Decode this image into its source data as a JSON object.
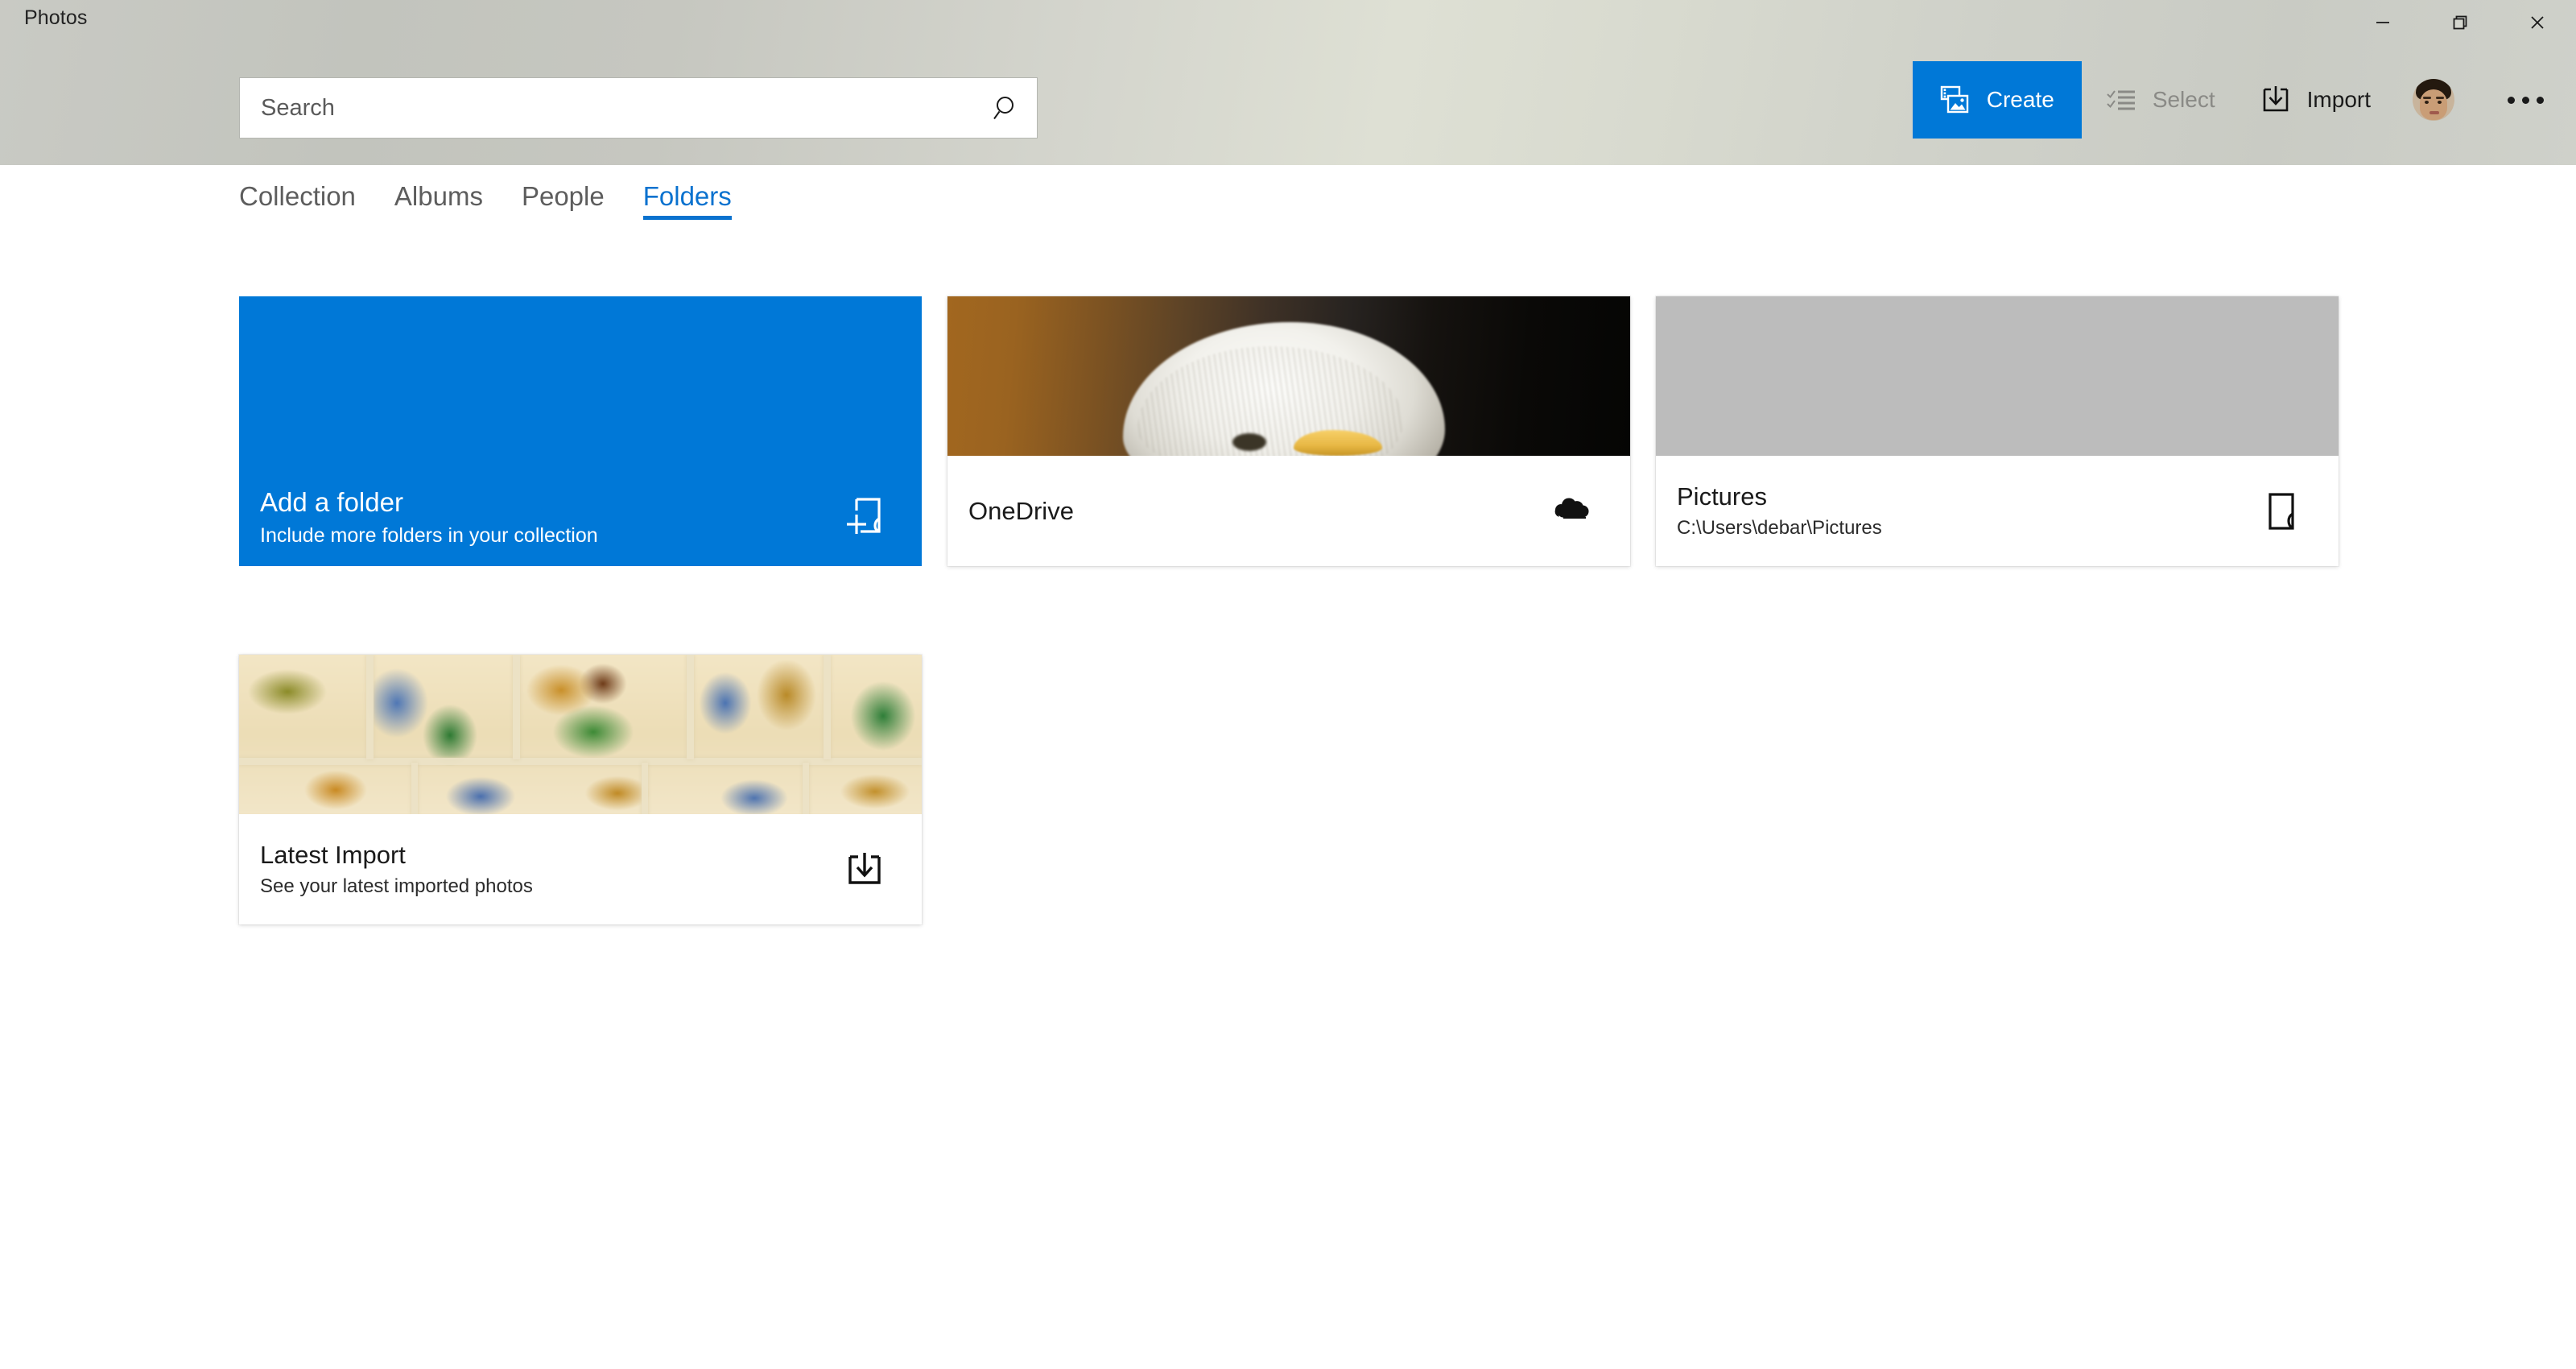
{
  "window": {
    "app_title": "Photos",
    "controls": [
      {
        "name": "minimize",
        "glyph": "minimize-icon"
      },
      {
        "name": "restore",
        "glyph": "restore-icon"
      },
      {
        "name": "close",
        "glyph": "close-icon"
      }
    ]
  },
  "search": {
    "placeholder": "Search",
    "value": "",
    "icon": "search-icon"
  },
  "commandbar": {
    "items": [
      {
        "label": "Create",
        "icon": "create-photo-video-icon",
        "state": "accent"
      },
      {
        "label": "Select",
        "icon": "select-checklist-icon",
        "state": "disabled"
      },
      {
        "label": "Import",
        "icon": "import-download-icon",
        "state": "normal"
      }
    ],
    "account": {
      "name": "account-avatar"
    },
    "more": {
      "label": "See more",
      "icon": "ellipsis-icon"
    }
  },
  "pivot": {
    "tabs": [
      {
        "label": "Collection",
        "active": false
      },
      {
        "label": "Albums",
        "active": false
      },
      {
        "label": "People",
        "active": false
      },
      {
        "label": "Folders",
        "active": true
      }
    ]
  },
  "folders": {
    "rows": [
      [
        {
          "title": "Add a folder",
          "subtitle": "Include more folders in your collection",
          "icon": "folder-add-icon",
          "style": "accent",
          "thumb": "none"
        },
        {
          "title": "OneDrive",
          "subtitle": "",
          "icon": "onedrive-cloud-icon",
          "style": "card",
          "thumb": "eagle"
        },
        {
          "title": "Pictures",
          "subtitle": "C:\\Users\\debar\\Pictures",
          "icon": "folder-icon",
          "style": "card",
          "thumb": "placeholder"
        }
      ],
      [
        {
          "title": "Latest Import",
          "subtitle": "See your latest imported photos",
          "icon": "import-download-icon",
          "style": "card",
          "thumb": "ceramic"
        }
      ]
    ]
  },
  "colors": {
    "accent": "#0078D7",
    "pivot_active": "#0A72CF",
    "chrome": "#CFD1CA",
    "tile_placeholder": "#BCBCBC",
    "disabled_text": "#8A8A86"
  }
}
